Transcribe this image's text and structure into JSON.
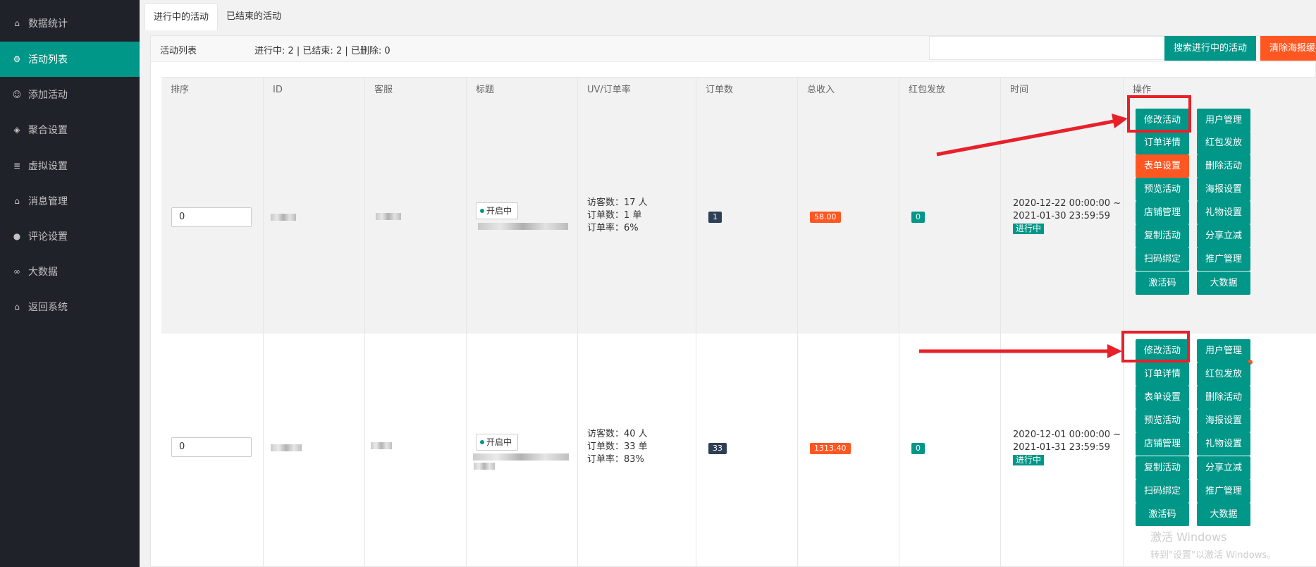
{
  "sidebar": {
    "items": [
      {
        "icon": "home-icon",
        "label": "数据统计"
      },
      {
        "icon": "gear-icon",
        "label": "活动列表"
      },
      {
        "icon": "user-icon",
        "label": "添加活动"
      },
      {
        "icon": "cube-icon",
        "label": "聚合设置"
      },
      {
        "icon": "list-icon",
        "label": "虚拟设置"
      },
      {
        "icon": "home-icon",
        "label": "消息管理"
      },
      {
        "icon": "chat-icon",
        "label": "评论设置"
      },
      {
        "icon": "infinity-icon",
        "label": "大数据"
      },
      {
        "icon": "home-icon",
        "label": "返回系统"
      }
    ],
    "active_index": 1
  },
  "tabs": [
    "进行中的活动",
    "已结束的活动"
  ],
  "panel": {
    "title": "活动列表",
    "stats": "进行中: 2 | 已结束: 2 | 已删除: 0",
    "search_button": "搜索进行中的活动",
    "clear_button": "清除海报缓存",
    "search_value": ""
  },
  "table": {
    "headers": [
      "排序",
      "ID",
      "客服",
      "标题",
      "UV/订单率",
      "订单数",
      "总收入",
      "红包发放",
      "时间",
      "操作"
    ],
    "rows": [
      {
        "sort": "0",
        "status": "开启中",
        "uv": [
          "访客数：17 人",
          "订单数：1 单",
          "订单率：6%"
        ],
        "orders": "1",
        "income": "58.00",
        "redpacket": "0",
        "time": [
          "2020-12-22 00:00:00 ~",
          "2021-01-30 23:59:59"
        ],
        "time_status": "进行中"
      },
      {
        "sort": "0",
        "status": "开启中",
        "uv": [
          "访客数：40 人",
          "订单数：33 单",
          "订单率：83%"
        ],
        "orders": "33",
        "income": "1313.40",
        "redpacket": "0",
        "time": [
          "2020-12-01 00:00:00 ~",
          "2021-01-31 23:59:59"
        ],
        "time_status": "进行中"
      }
    ],
    "actions": [
      [
        "修改活动",
        "用户管理"
      ],
      [
        "订单详情",
        "红包发放"
      ],
      [
        "表单设置",
        "删除活动"
      ],
      [
        "预览活动",
        "海报设置"
      ],
      [
        "店铺管理",
        "礼物设置"
      ],
      [
        "复制活动",
        "分享立减"
      ],
      [
        "扫码绑定",
        "推广管理"
      ],
      [
        "激活码",
        "大数据"
      ]
    ]
  },
  "watermark": [
    "激活 Windows",
    "转到\"设置\"以激活 Windows。"
  ],
  "colors": {
    "accent": "#009688",
    "sidebar": "#20222a",
    "orange": "#ff5722",
    "annotation": "#e8202a"
  }
}
